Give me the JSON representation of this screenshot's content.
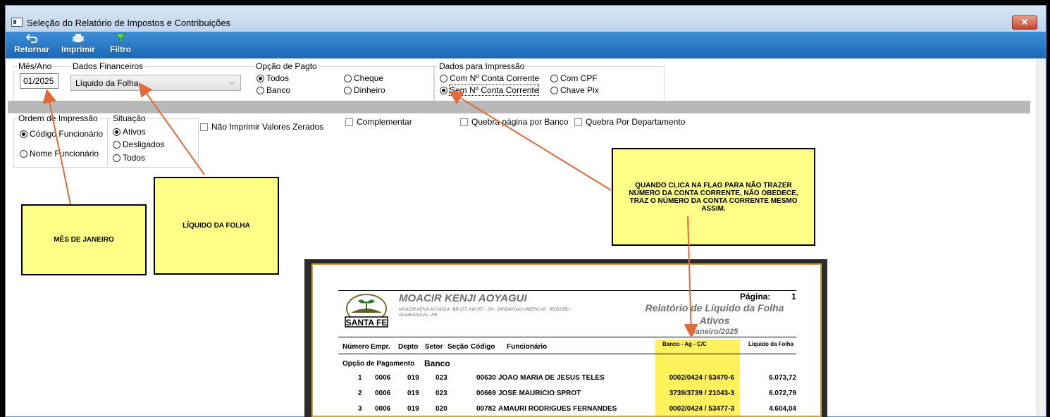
{
  "window": {
    "title": "Seleção do Relatório de Impostos e Contribuições",
    "close_label": "✕"
  },
  "toolbar": {
    "retornar": "Retornar",
    "imprimir": "Imprimir",
    "filtro": "Filtro"
  },
  "form": {
    "mes_ano_label": "Mês/Ano",
    "mes_ano_value": "01/2025",
    "dados_fin_label": "Dados Financeiros",
    "dados_fin_value": "Líquido da Folha",
    "opcao_pagto_label": "Opção de Pagto",
    "opcao_pagto_options": [
      "Todos",
      "Cheque",
      "Banco",
      "Dinheiro"
    ],
    "opcao_pagto_selected": "Todos",
    "dados_impressao_label": "Dados para Impressão",
    "dados_impressao_options": [
      "Com Nº Conta Corrente",
      "Com CPF",
      "Sem Nº Conta Corrente",
      "Chave Pix"
    ],
    "dados_impressao_selected": "Sem Nº Conta Corrente",
    "ordem_label": "Ordem de Impressão",
    "ordem_options": [
      "Código Funcionário",
      "Nome Funcionário"
    ],
    "ordem_selected": "Código Funcionário",
    "situacao_label": "Situação",
    "situacao_options": [
      "Ativos",
      "Desligados",
      "Todos"
    ],
    "situacao_selected": "Ativos",
    "nao_imprimir_zerados": "Não Imprimir Valores Zerados",
    "complementar": "Complementar",
    "quebra_banco": "Quebra página por Banco",
    "quebra_depto": "Quebra Por Departamento"
  },
  "notes": {
    "mes": "MÊS DE JANEIRO",
    "liquido": "LÍQUIDO DA FOLHA",
    "conta": "QUANDO CLICA NA FLAG PARA NÃO TRAZER NÚMERO DA CONTA CORRENTE, NÃO OBEDECE, TRAZ O NÚMERO DA CONTA CORRENTE MESMO ASSIM."
  },
  "report": {
    "logo_text": "SANTA FE",
    "company": "MOACIR KENJI AOYAGUI",
    "address1": "MOACIR KENJI AOYAGUI - BR 277, KM 357 - SN - JARDIM DAS AMERICAS - 85031350 -",
    "address2": "GUARAPUAVA - PR",
    "pagina_label": "Página:",
    "pagina_value": "1",
    "title": "Relatório de Líquido da Folha",
    "subtitle": "Ativos",
    "period": "Janeiro/2025",
    "headers": {
      "numero": "Número",
      "empr": "Empr.",
      "depto": "Depto",
      "setor": "Setor",
      "secao": "Seção",
      "codigo": "Código",
      "funcionario": "Funcionário",
      "banco": "Banco - Ag - C/C",
      "liquido": "Líquido da Folha"
    },
    "opcao_label": "Opção de Pagamento",
    "opcao_value": "Banco",
    "rows": [
      {
        "num": "1",
        "empr": "0006",
        "depto": "019",
        "setor": "023",
        "codigo": "00630",
        "nome": "JOAO MARIA DE JESUS TELES",
        "banco": "0002/0424 / 53470-6",
        "valor": "6.073,72"
      },
      {
        "num": "2",
        "empr": "0006",
        "depto": "019",
        "setor": "023",
        "codigo": "00669",
        "nome": "JOSE MAURICIO SPROT",
        "banco": "3739/3739 / 21043-3",
        "valor": "6.072,79"
      },
      {
        "num": "3",
        "empr": "0006",
        "depto": "019",
        "setor": "020",
        "codigo": "00782",
        "nome": "AMAURI RODRIGUES FERNANDES",
        "banco": "0002/0424 / 53477-3",
        "valor": "4.604,04"
      }
    ]
  }
}
